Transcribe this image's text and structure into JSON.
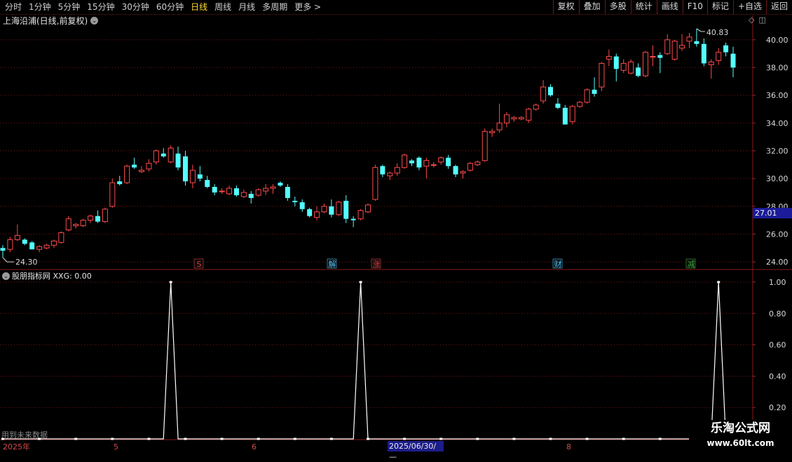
{
  "toolbar": {
    "periods": [
      "分时",
      "1分钟",
      "5分钟",
      "15分钟",
      "30分钟",
      "60分钟",
      "日线",
      "周线",
      "月线",
      "多周期",
      "更多 >"
    ],
    "active_period": "日线",
    "actions": [
      "复权",
      "叠加",
      "多股",
      "统计",
      "画线",
      "F10",
      "标记",
      "+自选",
      "返回"
    ]
  },
  "stock": {
    "title": "上海沿浦(日线,前复权)",
    "current_price_tag": "27.01",
    "high_marker": "40.83",
    "low_marker": "24.30"
  },
  "event_markers": [
    {
      "label": "S",
      "color": "#e04040"
    },
    {
      "label": "解",
      "color": "#4fc3f7"
    },
    {
      "label": "涨",
      "color": "#e04040"
    },
    {
      "label": "财",
      "color": "#4fc3f7"
    },
    {
      "label": "减",
      "color": "#3aaa3a"
    }
  ],
  "indicator": {
    "title": "股朋指标网 XXG: 0.00",
    "future_note": "用到未来数据"
  },
  "timeline": {
    "labels": [
      "2025年",
      "5",
      "6",
      "8"
    ],
    "cursor_date": "2025/06/30/—"
  },
  "watermark": {
    "title": "乐淘公式网",
    "url": "www.60lt.com"
  },
  "colors": {
    "up": "#ff4a4a",
    "down": "#54ffff",
    "grid": "#7a1616",
    "signal": "#ffffff"
  },
  "chart_data": [
    {
      "type": "candlestick",
      "title": "上海沿浦(日线,前复权)",
      "y_ticks": [
        24,
        26,
        28,
        30,
        32,
        34,
        36,
        38,
        40
      ],
      "ylim": [
        23.5,
        41
      ],
      "ohlc": [
        [
          25.0,
          25.2,
          24.3,
          24.8
        ],
        [
          24.9,
          25.8,
          24.7,
          25.6
        ],
        [
          25.6,
          26.7,
          25.5,
          25.9
        ],
        [
          25.6,
          25.7,
          25.2,
          25.3
        ],
        [
          25.4,
          25.5,
          24.9,
          24.9
        ],
        [
          24.9,
          25.2,
          24.7,
          25.1
        ],
        [
          25.0,
          25.3,
          24.9,
          25.2
        ],
        [
          25.2,
          25.6,
          25.0,
          25.5
        ],
        [
          25.4,
          26.2,
          25.3,
          26.1
        ],
        [
          26.3,
          27.3,
          26.2,
          27.1
        ],
        [
          26.6,
          26.8,
          26.4,
          26.7
        ],
        [
          26.6,
          27.1,
          26.5,
          27.0
        ],
        [
          27.0,
          27.4,
          26.8,
          27.3
        ],
        [
          27.3,
          27.7,
          26.8,
          26.9
        ],
        [
          26.9,
          27.9,
          26.8,
          27.8
        ],
        [
          28.0,
          30.0,
          27.9,
          29.7
        ],
        [
          29.8,
          30.2,
          29.5,
          29.6
        ],
        [
          29.7,
          31.0,
          29.6,
          30.9
        ],
        [
          31.0,
          31.5,
          30.7,
          30.8
        ],
        [
          30.5,
          30.9,
          30.4,
          30.6
        ],
        [
          30.7,
          31.4,
          30.5,
          31.1
        ],
        [
          31.2,
          32.1,
          31.0,
          32.0
        ],
        [
          31.8,
          32.2,
          31.5,
          31.6
        ],
        [
          31.2,
          32.4,
          31.1,
          32.2
        ],
        [
          31.8,
          32.3,
          30.6,
          30.8
        ],
        [
          31.6,
          32.0,
          29.5,
          29.8
        ],
        [
          29.7,
          31.0,
          29.3,
          30.6
        ],
        [
          30.3,
          30.9,
          29.8,
          30.0
        ],
        [
          29.9,
          30.2,
          29.3,
          29.4
        ],
        [
          29.4,
          29.6,
          28.8,
          29.0
        ],
        [
          29.1,
          29.3,
          28.9,
          29.1
        ],
        [
          28.9,
          29.5,
          28.8,
          29.3
        ],
        [
          29.3,
          29.5,
          28.7,
          28.8
        ],
        [
          28.7,
          29.2,
          28.6,
          29.0
        ],
        [
          28.9,
          29.1,
          28.2,
          28.6
        ],
        [
          28.8,
          29.3,
          28.7,
          29.2
        ],
        [
          29.1,
          29.6,
          28.8,
          29.3
        ],
        [
          29.3,
          29.6,
          28.9,
          29.4
        ],
        [
          29.7,
          29.8,
          29.4,
          29.5
        ],
        [
          29.4,
          29.6,
          28.4,
          28.6
        ],
        [
          28.4,
          28.7,
          28.0,
          28.3
        ],
        [
          28.3,
          28.5,
          27.6,
          27.8
        ],
        [
          27.8,
          27.9,
          27.2,
          27.3
        ],
        [
          27.2,
          28.0,
          27.0,
          27.6
        ],
        [
          27.6,
          28.2,
          27.5,
          28.0
        ],
        [
          28.0,
          28.5,
          27.2,
          27.4
        ],
        [
          27.4,
          28.4,
          27.3,
          28.3
        ],
        [
          28.4,
          28.8,
          26.8,
          27.1
        ],
        [
          27.1,
          27.3,
          26.5,
          27.0
        ],
        [
          27.1,
          27.8,
          27.0,
          27.7
        ],
        [
          27.6,
          28.2,
          27.5,
          28.1
        ],
        [
          28.5,
          31.0,
          28.4,
          30.8
        ],
        [
          30.9,
          31.0,
          30.1,
          30.3
        ],
        [
          30.2,
          30.5,
          29.9,
          30.4
        ],
        [
          30.4,
          31.1,
          30.2,
          30.8
        ],
        [
          30.8,
          31.8,
          30.7,
          31.7
        ],
        [
          31.3,
          31.4,
          30.9,
          31.1
        ],
        [
          31.5,
          31.6,
          30.6,
          30.8
        ],
        [
          30.9,
          31.5,
          30.0,
          31.3
        ],
        [
          31.0,
          31.2,
          30.8,
          31.0
        ],
        [
          31.2,
          31.6,
          31.0,
          31.5
        ],
        [
          31.5,
          31.7,
          30.7,
          30.9
        ],
        [
          30.9,
          31.0,
          30.1,
          30.3
        ],
        [
          30.4,
          30.6,
          30.0,
          30.5
        ],
        [
          30.6,
          31.2,
          30.5,
          31.1
        ],
        [
          31.0,
          31.3,
          30.9,
          31.2
        ],
        [
          31.3,
          33.6,
          31.2,
          33.4
        ],
        [
          33.3,
          33.6,
          33.0,
          33.4
        ],
        [
          33.5,
          35.4,
          33.3,
          34.0
        ],
        [
          34.0,
          34.8,
          33.7,
          34.6
        ],
        [
          34.3,
          34.5,
          34.1,
          34.4
        ],
        [
          34.3,
          34.5,
          34.2,
          34.4
        ],
        [
          34.2,
          35.1,
          34.0,
          35.0
        ],
        [
          35.0,
          35.4,
          34.9,
          35.3
        ],
        [
          35.6,
          37.1,
          35.4,
          36.6
        ],
        [
          36.6,
          36.8,
          35.9,
          36.0
        ],
        [
          35.4,
          35.8,
          35.0,
          35.1
        ],
        [
          35.1,
          35.3,
          33.9,
          33.9
        ],
        [
          34.1,
          35.3,
          33.9,
          35.2
        ],
        [
          35.2,
          35.6,
          35.1,
          35.5
        ],
        [
          35.5,
          36.5,
          35.4,
          36.4
        ],
        [
          36.4,
          37.3,
          35.9,
          36.1
        ],
        [
          36.6,
          38.4,
          36.3,
          38.3
        ],
        [
          38.6,
          39.3,
          38.1,
          38.8
        ],
        [
          38.8,
          39.0,
          37.0,
          37.9
        ],
        [
          37.8,
          38.6,
          37.6,
          38.3
        ],
        [
          37.6,
          38.6,
          37.5,
          38.4
        ],
        [
          38.0,
          38.3,
          37.3,
          37.4
        ],
        [
          37.4,
          39.2,
          37.3,
          39.1
        ],
        [
          38.8,
          39.6,
          38.1,
          38.8
        ],
        [
          38.9,
          39.1,
          37.6,
          38.7
        ],
        [
          39.0,
          40.4,
          38.9,
          40.0
        ],
        [
          38.6,
          40.0,
          38.5,
          39.9
        ],
        [
          39.4,
          40.4,
          39.2,
          39.6
        ],
        [
          39.9,
          40.5,
          39.4,
          40.2
        ],
        [
          39.9,
          40.8,
          39.5,
          39.7
        ],
        [
          39.7,
          40.1,
          38.1,
          38.3
        ],
        [
          38.2,
          38.6,
          37.2,
          38.4
        ],
        [
          38.5,
          39.4,
          38.2,
          39.1
        ],
        [
          39.6,
          39.8,
          38.8,
          39.1
        ],
        [
          39.0,
          39.5,
          37.3,
          38.0
        ]
      ],
      "price_tag": 27.01
    },
    {
      "type": "line",
      "series": [
        {
          "name": "XXG",
          "values": "signal"
        }
      ],
      "y_ticks": [
        0.2,
        0.4,
        0.6,
        0.8,
        1.0
      ],
      "ylim": [
        0,
        1.04
      ],
      "signal_indices": [
        23,
        49,
        98
      ]
    }
  ]
}
